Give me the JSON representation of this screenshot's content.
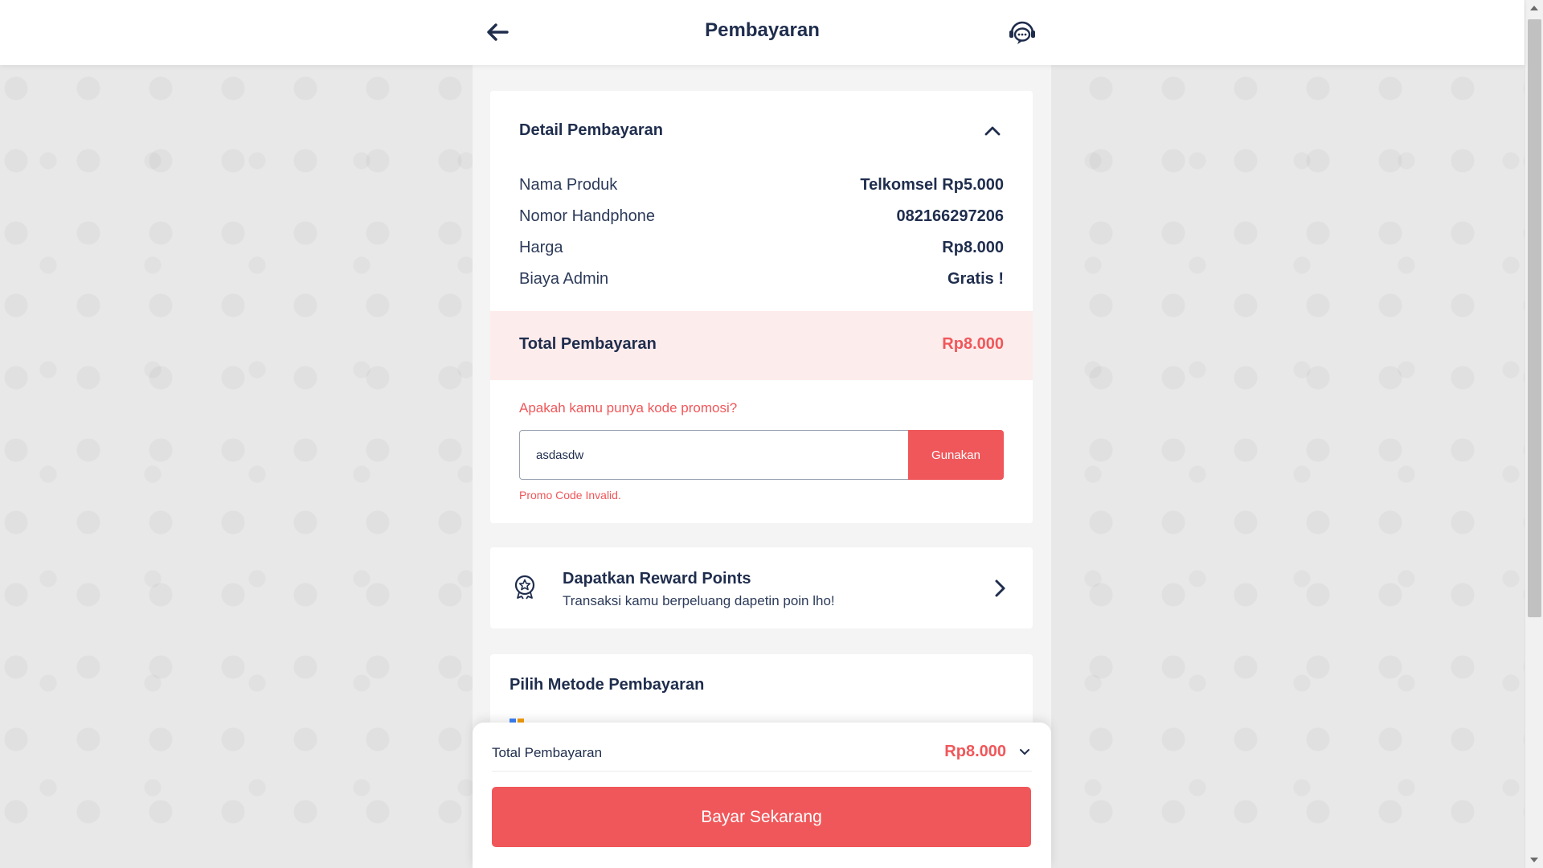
{
  "header": {
    "title": "Pembayaran",
    "back_icon": "arrow-left-icon",
    "support_icon": "chat-support-icon"
  },
  "detail": {
    "title": "Detail Pembayaran",
    "rows": [
      {
        "label": "Nama Produk",
        "value": "Telkomsel Rp5.000"
      },
      {
        "label": "Nomor Handphone",
        "value": "082166297206"
      },
      {
        "label": "Harga",
        "value": "Rp8.000"
      },
      {
        "label": "Biaya Admin",
        "value": "Gratis !"
      }
    ],
    "total_label": "Total Pembayaran",
    "total_value": "Rp8.000"
  },
  "promo": {
    "question": "Apakah kamu punya kode promosi?",
    "input_value": "asdasdw",
    "button_label": "Gunakan",
    "error": "Promo Code Invalid."
  },
  "reward": {
    "title": "Dapatkan Reward Points",
    "subtitle": "Transaksi kamu berpeluang dapetin poin lho!"
  },
  "method": {
    "title": "Pilih Metode Pembayaran"
  },
  "bottom_sheet": {
    "total_label": "Total Pembayaran",
    "total_value": "Rp8.000",
    "pay_button": "Bayar Sekarang"
  },
  "colors": {
    "accent": "#f0575a",
    "navy": "#1f2d4d",
    "highlight": "#fdecec"
  }
}
